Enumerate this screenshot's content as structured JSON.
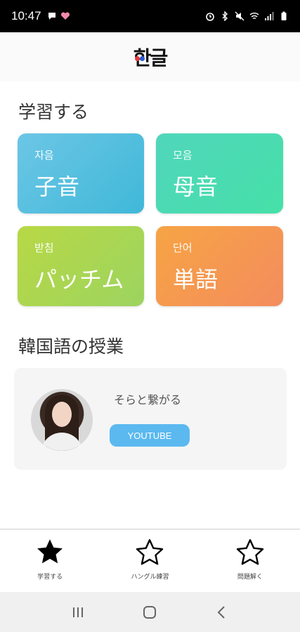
{
  "status_bar": {
    "time": "10:47",
    "left_icons": [
      "chat-bubble-icon",
      "heart-icon"
    ],
    "right_icons": [
      "alarm-icon",
      "bluetooth-icon",
      "mute-icon",
      "wifi-icon",
      "signal-icon",
      "battery-icon"
    ]
  },
  "app_bar": {
    "logo_text": "한글"
  },
  "study_section": {
    "title": "学習する",
    "cards": [
      {
        "korean": "자음",
        "japanese": "子音",
        "color_start": "#6cc6e6",
        "color_end": "#40b8d8"
      },
      {
        "korean": "모음",
        "japanese": "母音",
        "color_start": "#50d6bc",
        "color_end": "#46e0a8"
      },
      {
        "korean": "받침",
        "japanese": "パッチム",
        "color_start": "#b8d845",
        "color_end": "#9cd460"
      },
      {
        "korean": "단어",
        "japanese": "単語",
        "color_start": "#f6a444",
        "color_end": "#f48c5e"
      }
    ]
  },
  "lesson_section": {
    "title": "韓国語の授業",
    "card": {
      "name": "そらと繋がる",
      "button_label": "YOUTUBE",
      "button_color": "#5bb9f0"
    }
  },
  "bottom_nav": {
    "items": [
      {
        "label": "学習する",
        "icon": "star-filled-icon",
        "active": true
      },
      {
        "label": "ハングル練習",
        "icon": "star-outline-icon",
        "active": false
      },
      {
        "label": "問題解く",
        "icon": "star-outline-icon",
        "active": false
      }
    ]
  },
  "system_nav": {
    "buttons": [
      "recent-apps-icon",
      "home-icon",
      "back-icon"
    ]
  }
}
